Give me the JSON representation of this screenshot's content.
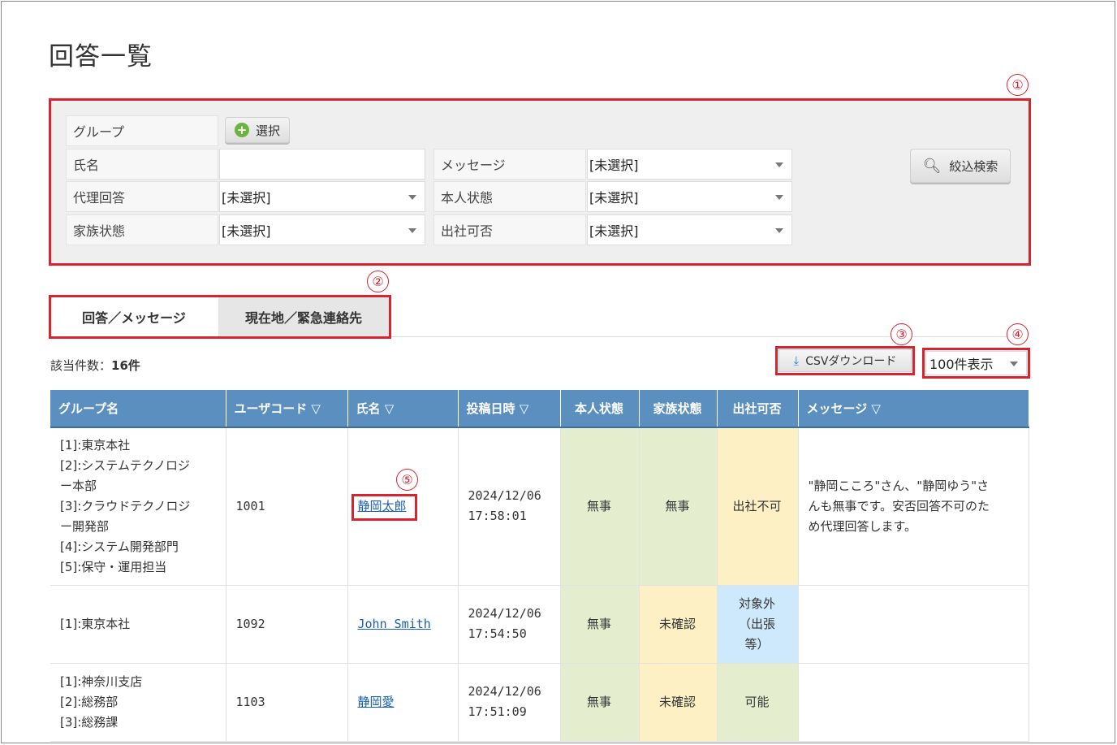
{
  "page": {
    "title": "回答一覧"
  },
  "callouts": [
    "①",
    "②",
    "③",
    "④",
    "⑤"
  ],
  "search": {
    "group_label": "グループ",
    "select_button": "選択",
    "name_label": "氏名",
    "name_value": "",
    "message_label": "メッセージ",
    "message_value": "[未選択]",
    "proxy_label": "代理回答",
    "proxy_value": "[未選択]",
    "self_status_label": "本人状態",
    "self_status_value": "[未選択]",
    "family_label": "家族状態",
    "family_value": "[未選択]",
    "attend_label": "出社可否",
    "attend_value": "[未選択]",
    "search_button": "絞込検索"
  },
  "tabs": [
    {
      "label": "回答／メッセージ",
      "active": true
    },
    {
      "label": "現在地／緊急連絡先",
      "active": false
    }
  ],
  "result": {
    "count_label": "該当件数：",
    "count_value": "16件",
    "csv_button": "CSVダウンロード",
    "per_page": "100件表示"
  },
  "table": {
    "headers": [
      "グループ名",
      "ユーザコード ▽",
      "氏名 ▽",
      "投稿日時 ▽",
      "本人状態",
      "家族状態",
      "出社可否",
      "メッセージ ▽"
    ],
    "rows": [
      {
        "groups": [
          "[1]:東京本社",
          "[2]:システムテクノロジ",
          "ー本部",
          "[3]:クラウドテクノロジ",
          "ー開発部",
          "[4]:システム開発部門",
          "[5]:保守・運用担当"
        ],
        "code": "1001",
        "name": "静岡太郎",
        "date": "2024/12/06",
        "time": "17:58:01",
        "self": "無事",
        "family": "無事",
        "attend": "出社不可",
        "message_lines": [
          "\"静岡こころ\"さん、\"静岡ゆう\"さ",
          "んも無事です。安否回答不可のた",
          "め代理回答します。"
        ]
      },
      {
        "groups": [
          "[1]:東京本社"
        ],
        "code": "1092",
        "name": "John Smith",
        "date": "2024/12/06",
        "time": "17:54:50",
        "self": "無事",
        "family": "未確認",
        "attend_lines": [
          "対象外",
          "（出張",
          "等）"
        ],
        "message_lines": []
      },
      {
        "groups": [
          "[1]:神奈川支店",
          "[2]:総務部",
          "[3]:総務課"
        ],
        "code": "1103",
        "name": "静岡愛",
        "date": "2024/12/06",
        "time": "17:51:09",
        "self": "無事",
        "family": "未確認",
        "attend": "可能",
        "message_lines": []
      }
    ]
  },
  "colors": {
    "accent_red": "#d9232e",
    "header_blue": "#5b8fc0",
    "status_green": "#e5edcf",
    "status_yellow": "#fcf0c4",
    "status_blue": "#cde9fb",
    "link": "#1a5fb4"
  }
}
